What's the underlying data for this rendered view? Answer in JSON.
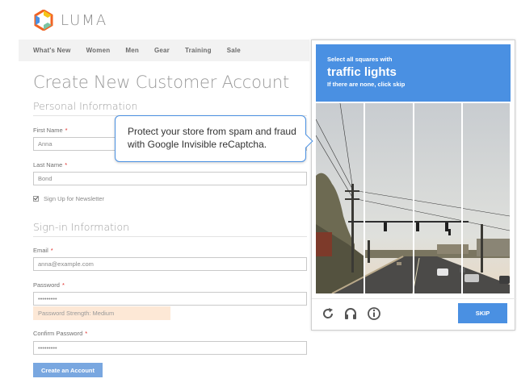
{
  "brand": {
    "name": "LUMA",
    "colors": [
      "#f26322",
      "#7bc4a4",
      "#4a90e2",
      "#f5c518"
    ]
  },
  "nav": {
    "items": [
      "What's New",
      "Women",
      "Men",
      "Gear",
      "Training",
      "Sale"
    ]
  },
  "page": {
    "title": "Create New Customer Account"
  },
  "personal": {
    "title": "Personal Information",
    "first_name": {
      "label": "First Name",
      "required": "*",
      "value": "Anna"
    },
    "last_name": {
      "label": "Last Name",
      "required": "*",
      "value": "Bond"
    },
    "newsletter": {
      "label": "Sign Up for Newsletter",
      "checked": true
    }
  },
  "signin": {
    "title": "Sign-in Information",
    "email": {
      "label": "Email",
      "required": "*",
      "value": "anna@example.com"
    },
    "password": {
      "label": "Password",
      "required": "*",
      "value": "•••••••••",
      "strength": "Password Strength: Medium"
    },
    "confirm": {
      "label": "Confirm Password",
      "required": "*",
      "value": "•••••••••"
    },
    "submit_label": "Create an Account"
  },
  "captcha": {
    "instruction": "Select all squares with",
    "target": "traffic lights",
    "hint": "If there are none, click skip",
    "skip_label": "SKIP",
    "icons": [
      "reload-icon",
      "audio-icon",
      "info-icon"
    ],
    "accent": "#4a90e2"
  },
  "callout": {
    "text": "Protect your store from spam and fraud with Google Invisible reCaptcha."
  }
}
